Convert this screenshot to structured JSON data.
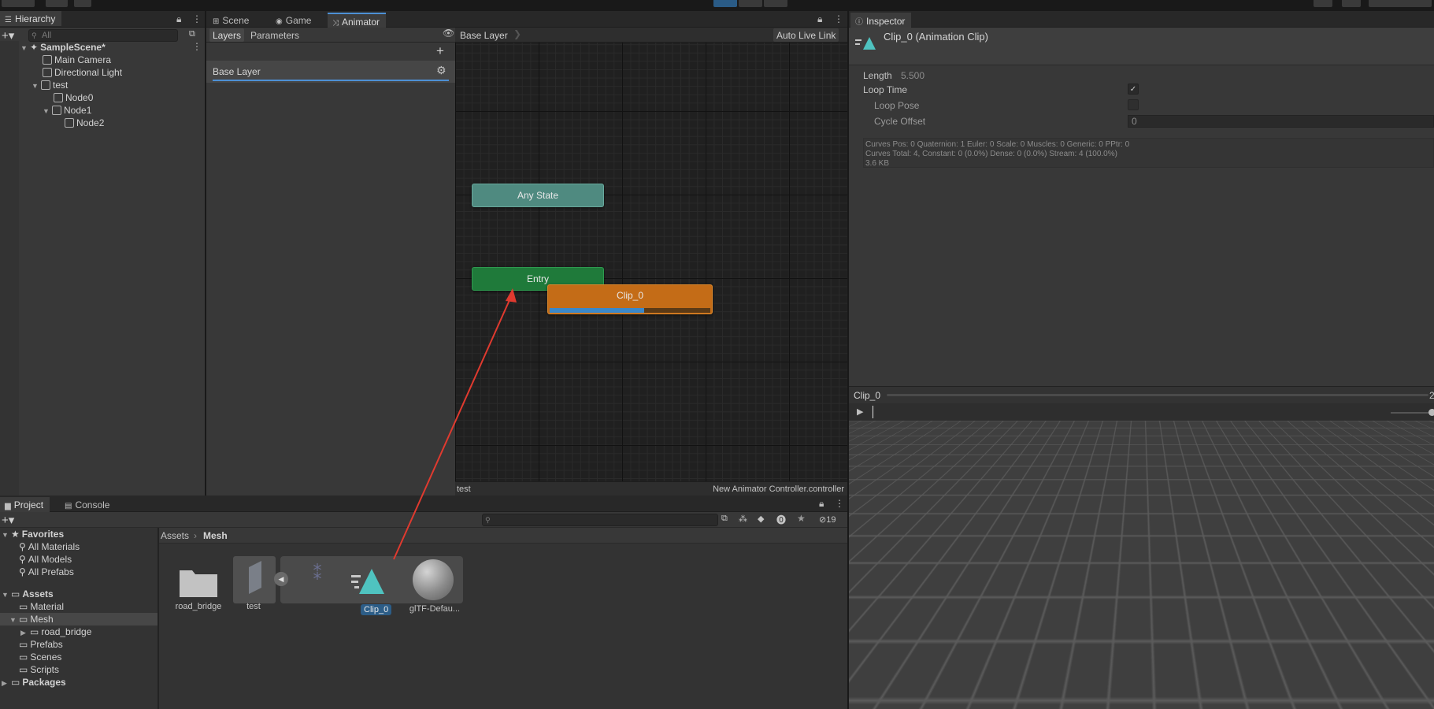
{
  "hierarchy": {
    "tab": "Hierarchy",
    "search_placeholder": "All",
    "scene": "SampleScene*",
    "items": [
      "Main Camera",
      "Directional Light",
      "test",
      "Node0",
      "Node1",
      "Node2"
    ]
  },
  "center_tabs": [
    "Scene",
    "Game",
    "Animator"
  ],
  "animator": {
    "subtabs": [
      "Layers",
      "Parameters"
    ],
    "breadcrumb": "Base Layer",
    "auto_live_link": "Auto Live Link",
    "layer_name": "Base Layer",
    "states": {
      "any": "Any State",
      "entry": "Entry",
      "clip": "Clip_0"
    },
    "clip_progress": 0.59,
    "footer_left": "test",
    "footer_right": "New Animator Controller.controller"
  },
  "inspector": {
    "tab": "Inspector",
    "title": "Clip_0 (Animation Clip)",
    "length_label": "Length",
    "length_value": "5.500",
    "loop_time": "Loop Time",
    "loop_pose": "Loop Pose",
    "cycle_offset": "Cycle Offset",
    "cycle_offset_value": "0",
    "stats": [
      "Curves Pos: 0 Quaternion: 1 Euler: 0 Scale: 0 Muscles: 0 Generic: 0 PPtr: 0",
      "Curves Total: 4, Constant: 0 (0.0%) Dense: 0 (0.0%) Stream: 4 (100.0%)",
      "3.6 KB"
    ],
    "preview_title": "Clip_0",
    "preview_num": "2"
  },
  "project": {
    "tabs": [
      "Project",
      "Console"
    ],
    "hidden_count": "19",
    "favorites": "Favorites",
    "fav_items": [
      "All Materials",
      "All Models",
      "All Prefabs"
    ],
    "assets": "Assets",
    "asset_items": [
      "Material",
      "Mesh",
      "road_bridge",
      "Prefabs",
      "Scenes",
      "Scripts"
    ],
    "packages": "Packages",
    "breadcrumb_root": "Assets",
    "breadcrumb_leaf": "Mesh",
    "files": [
      "road_bridge",
      "test",
      "Clip_0",
      "glTF-Defau..."
    ]
  },
  "colors": {
    "accent": "#4d90d5",
    "any_state": "#4f8a80",
    "entry": "#1f7a3a",
    "clip": "#c46c17",
    "arrow": "#e03a2f"
  }
}
